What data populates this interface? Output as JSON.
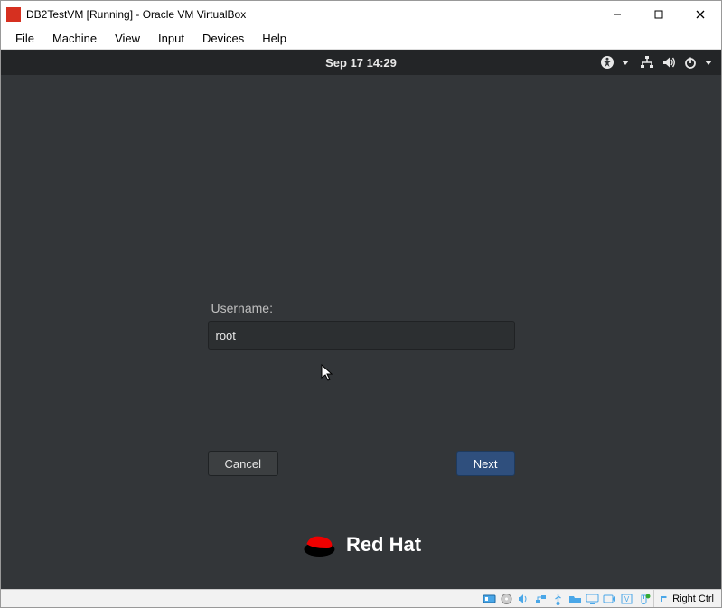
{
  "host": {
    "title": "DB2TestVM [Running] - Oracle VM VirtualBox",
    "menus": {
      "file": "File",
      "machine": "Machine",
      "view": "View",
      "input": "Input",
      "devices": "Devices",
      "help": "Help"
    },
    "hostkey": "Right Ctrl"
  },
  "guest": {
    "topbar": {
      "datetime": "Sep 17  14:29"
    },
    "login": {
      "username_label": "Username:",
      "username_value": "root",
      "cancel": "Cancel",
      "next": "Next"
    },
    "brand": "Red Hat"
  }
}
